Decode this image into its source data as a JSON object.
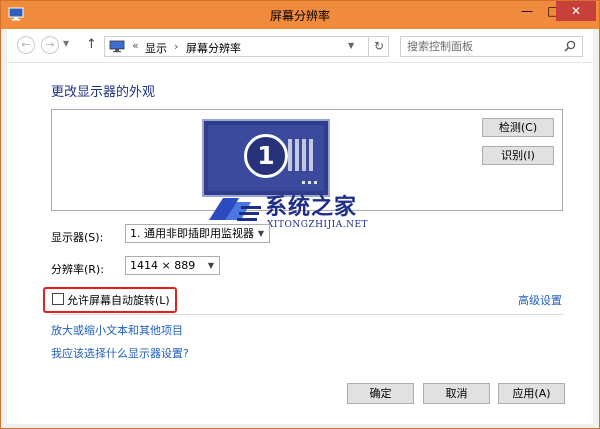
{
  "window": {
    "title": "屏幕分辨率",
    "minimize_glyph": "—",
    "maximize_glyph": "□",
    "close_glyph": "✕"
  },
  "addressbar": {
    "back_icon": "←",
    "forward_icon": "→",
    "up_icon": "↑",
    "separator0": "«",
    "breadcrumb": [
      "显示",
      "屏幕分辨率"
    ],
    "separator": "›",
    "refresh_icon": "↻",
    "search_placeholder": "搜索控制面板"
  },
  "main": {
    "heading": "更改显示器的外观",
    "monitor_number": "1",
    "detect_button": "检测(C)",
    "identify_button": "识别(I)",
    "display_label": "显示器(S):",
    "display_value": "1. 通用非即插即用监视器",
    "resolution_label": "分辨率(R):",
    "resolution_value": "1414 × 889",
    "auto_rotate_label": "允许屏幕自动旋转(L)",
    "auto_rotate_checked": false,
    "advanced_link": "高级设置",
    "link_text_size": "放大或缩小文本和其他项目",
    "link_which_settings": "我应该选择什么显示器设置?"
  },
  "watermark": {
    "title": "系统之家",
    "subtitle": "XITONGZHIJIA.NET"
  },
  "footer": {
    "ok": "确定",
    "cancel": "取消",
    "apply": "应用(A)"
  },
  "colors": {
    "titlebar": "#f08a3c",
    "heading": "#1e3287",
    "link": "#1f5fbd",
    "highlight": "#e1211d"
  }
}
